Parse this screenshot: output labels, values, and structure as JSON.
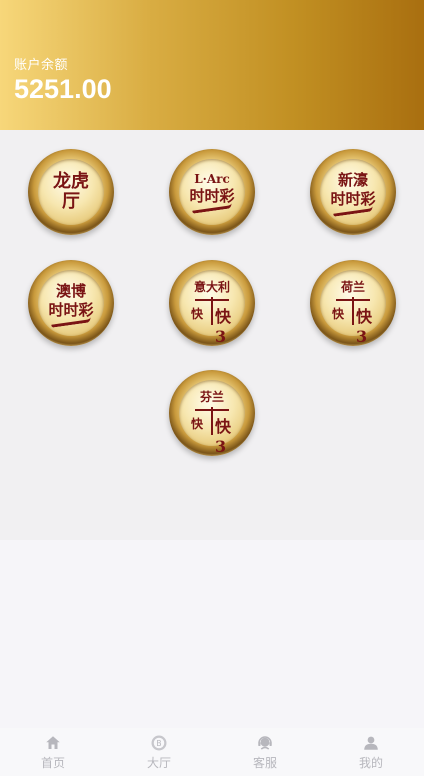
{
  "account": {
    "balance_label": "账户余额",
    "balance_value": "5251.00"
  },
  "games": [
    {
      "id": "longhu",
      "line1": "龙虎",
      "line2": "厅",
      "style": "text"
    },
    {
      "id": "larc",
      "line1": "L·Arc",
      "line2": "时时彩",
      "style": "ssc"
    },
    {
      "id": "xinhao",
      "line1": "新濠",
      "line2": "时时彩",
      "style": "ssc"
    },
    {
      "id": "aobo",
      "line1": "澳博",
      "line2": "时时彩",
      "style": "ssc"
    },
    {
      "id": "italy",
      "line1": "意大利",
      "line2": "快3",
      "style": "k3"
    },
    {
      "id": "holland",
      "line1": "荷兰",
      "line2": "快3",
      "style": "k3"
    },
    {
      "id": "finland",
      "line1": "芬兰",
      "line2": "快3",
      "style": "k3"
    }
  ],
  "tabbar": {
    "items": [
      {
        "label": "首页",
        "icon": "home-icon"
      },
      {
        "label": "大厅",
        "icon": "bitcoin-icon"
      },
      {
        "label": "客服",
        "icon": "headset-icon"
      },
      {
        "label": "我的",
        "icon": "user-icon"
      }
    ]
  },
  "colors": {
    "header_start": "#f7d77a",
    "header_end": "#a96f10",
    "coin_text": "#7a1414",
    "tab_inactive": "#b7b7bd"
  }
}
